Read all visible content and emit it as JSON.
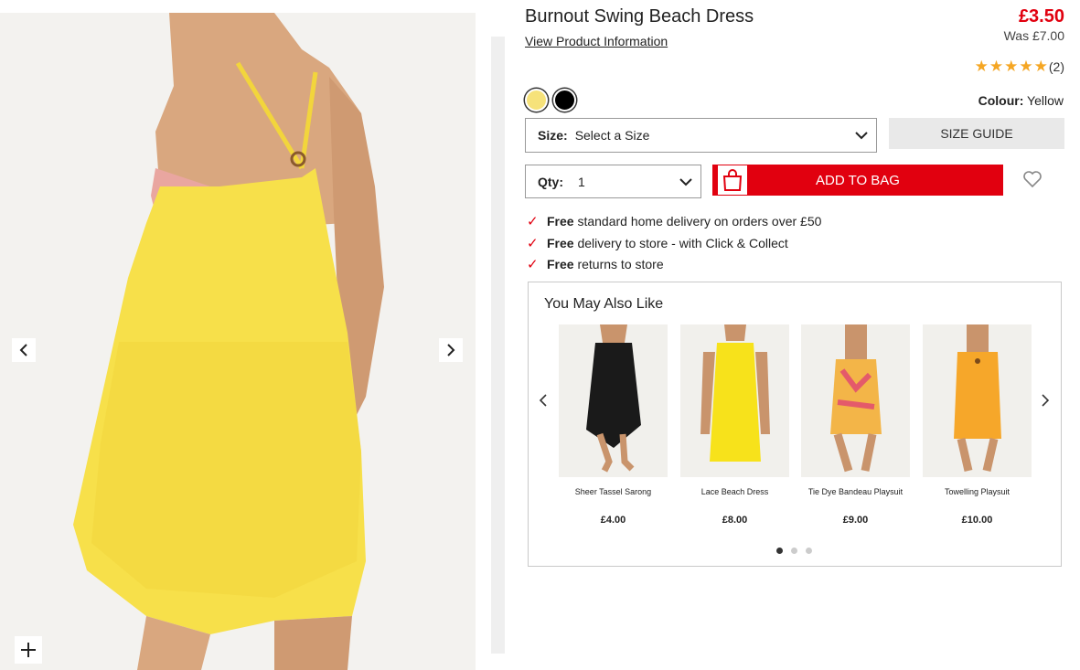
{
  "product": {
    "title": "Burnout Swing Beach Dress",
    "info_link": "View Product Information",
    "price": "£3.50",
    "was_price": "Was £7.00",
    "rating_stars": 5,
    "review_count": "(2)",
    "colour_label": "Colour:",
    "colour_value": "Yellow",
    "swatches": [
      {
        "name": "Yellow",
        "color": "#f6e27a"
      },
      {
        "name": "Black",
        "color": "#000000"
      }
    ],
    "size_label": "Size:",
    "size_value": "Select a Size",
    "size_guide": "SIZE GUIDE",
    "qty_label": "Qty:",
    "qty_value": "1",
    "add_to_bag": "ADD TO BAG"
  },
  "benefits": [
    {
      "bold": "Free",
      "text": "standard home delivery on orders over £50"
    },
    {
      "bold": "Free",
      "text": "delivery to store - with Click & Collect"
    },
    {
      "bold": "Free",
      "text": "returns to store"
    }
  ],
  "recommendations": {
    "title": "You May Also Like",
    "items": [
      {
        "name": "Sheer Tassel Sarong",
        "price": "£4.00",
        "garment_color": "#1a1a1a"
      },
      {
        "name": "Lace Beach Dress",
        "price": "£8.00",
        "garment_color": "#f7e21b"
      },
      {
        "name": "Tie Dye Bandeau Playsuit",
        "price": "£9.00",
        "garment_color": "#f3b548"
      },
      {
        "name": "Towelling Playsuit",
        "price": "£10.00",
        "garment_color": "#f6a72a"
      }
    ],
    "page_count": 3,
    "active_page": 1
  },
  "colors": {
    "accent": "#e1000f",
    "star": "#f5a623",
    "dress": "#f7e04a"
  }
}
